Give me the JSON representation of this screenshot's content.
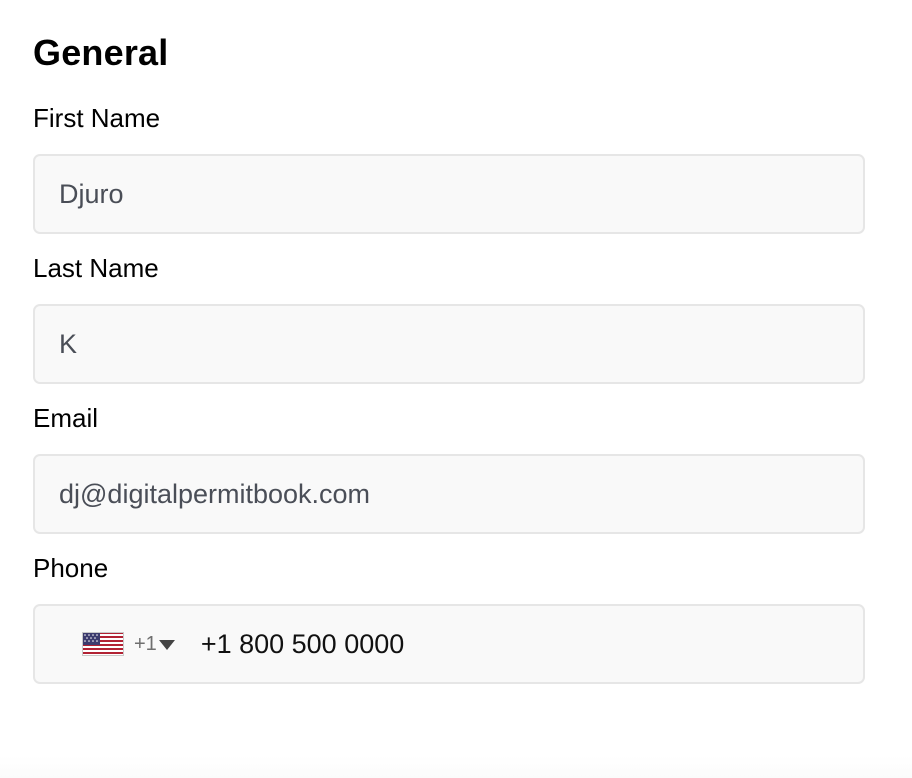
{
  "section": {
    "title": "General"
  },
  "fields": {
    "first_name": {
      "label": "First Name",
      "value": "Djuro"
    },
    "last_name": {
      "label": "Last Name",
      "value": "K"
    },
    "email": {
      "label": "Email",
      "value": "dj@digitalpermitbook.com"
    },
    "phone": {
      "label": "Phone",
      "country_flag": "us-flag-icon",
      "dial_code": "+1",
      "value": "+1 800 500 0000"
    }
  },
  "colors": {
    "input_background": "#f9f9f9",
    "input_border": "#e6e6e6",
    "input_text": "#4a4e57",
    "label_text": "#000000"
  }
}
